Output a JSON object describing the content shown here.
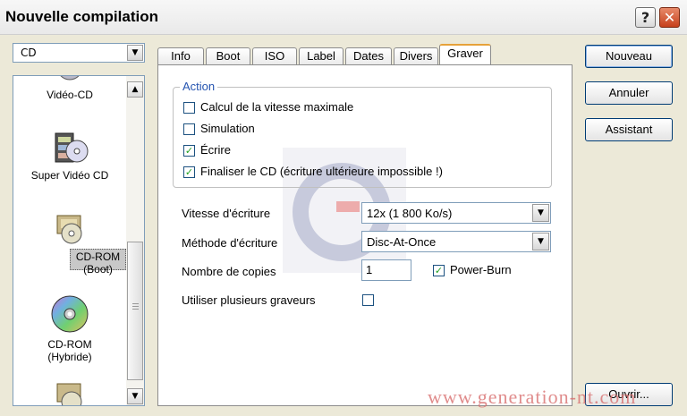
{
  "window": {
    "title": "Nouvelle compilation",
    "help": "?",
    "close": "✕"
  },
  "media_combo": {
    "value": "CD"
  },
  "compilation_types": [
    {
      "label": "Vidéo-CD",
      "icon": "video-cd-icon"
    },
    {
      "label": "Super Vidéo CD",
      "icon": "film-cd-icon"
    },
    {
      "label": "CD-ROM (Boot)",
      "icon": "boot-cd-icon",
      "selected": true
    },
    {
      "label": "CD-ROM (Hybride)",
      "icon": "hybrid-cd-icon"
    }
  ],
  "tabs": [
    "Info",
    "Boot",
    "ISO",
    "Label",
    "Dates",
    "Divers",
    "Graver"
  ],
  "active_tab": "Graver",
  "action_group": {
    "title": "Action",
    "options": [
      {
        "label": "Calcul de la vitesse maximale",
        "checked": false
      },
      {
        "label": "Simulation",
        "checked": false
      },
      {
        "label": "Écrire",
        "checked": true
      },
      {
        "label": "Finaliser le CD (écriture ultérieure impossible !)",
        "checked": true
      }
    ]
  },
  "fields": {
    "speed_label": "Vitesse d'écriture",
    "speed_value": "12x (1 800 Ko/s)",
    "method_label": "Méthode d'écriture",
    "method_value": "Disc-At-Once",
    "copies_label": "Nombre de copies",
    "copies_value": "1",
    "powerburn_label": "Power-Burn",
    "powerburn_checked": true,
    "multi_label": "Utiliser plusieurs graveurs",
    "multi_checked": false
  },
  "buttons": {
    "new": "Nouveau",
    "cancel": "Annuler",
    "wizard": "Assistant",
    "open": "Ouvrir..."
  },
  "watermark": "www.generation-nt.com"
}
